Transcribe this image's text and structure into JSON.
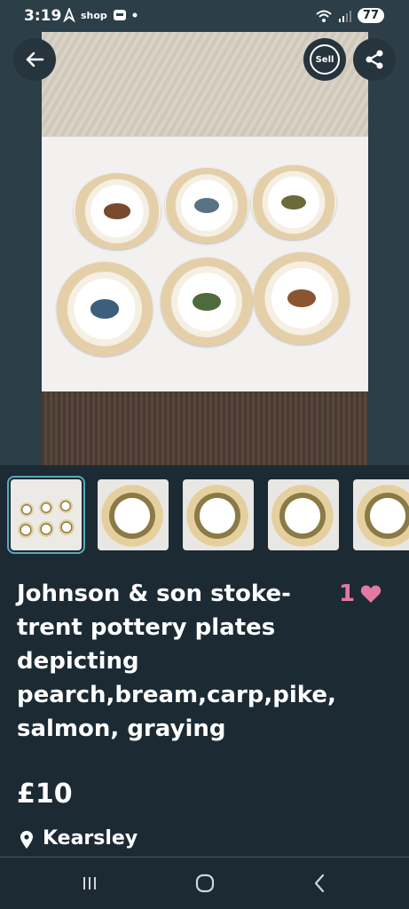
{
  "status_bar": {
    "time": "3:19",
    "shop_label": "shop",
    "battery": "77"
  },
  "header": {
    "sell_label": "Sell"
  },
  "listing": {
    "title": "Johnson & son stoke- trent pottery plates depicting pearch,bream,carp,pike, salmon, graying",
    "likes": "1",
    "price": "£10",
    "location": "Kearsley"
  },
  "thumbnails": [
    {
      "selected": true
    },
    {
      "selected": false
    },
    {
      "selected": false
    },
    {
      "selected": false
    },
    {
      "selected": false
    }
  ],
  "colors": {
    "background": "#1c2a34",
    "like_accent": "#e37aa2",
    "thumb_selected": "#5aa9b8"
  },
  "icons": [
    "back-arrow-icon",
    "sell-icon",
    "share-icon",
    "heart-icon",
    "location-pin-icon",
    "recents-icon",
    "home-icon",
    "back-icon"
  ]
}
